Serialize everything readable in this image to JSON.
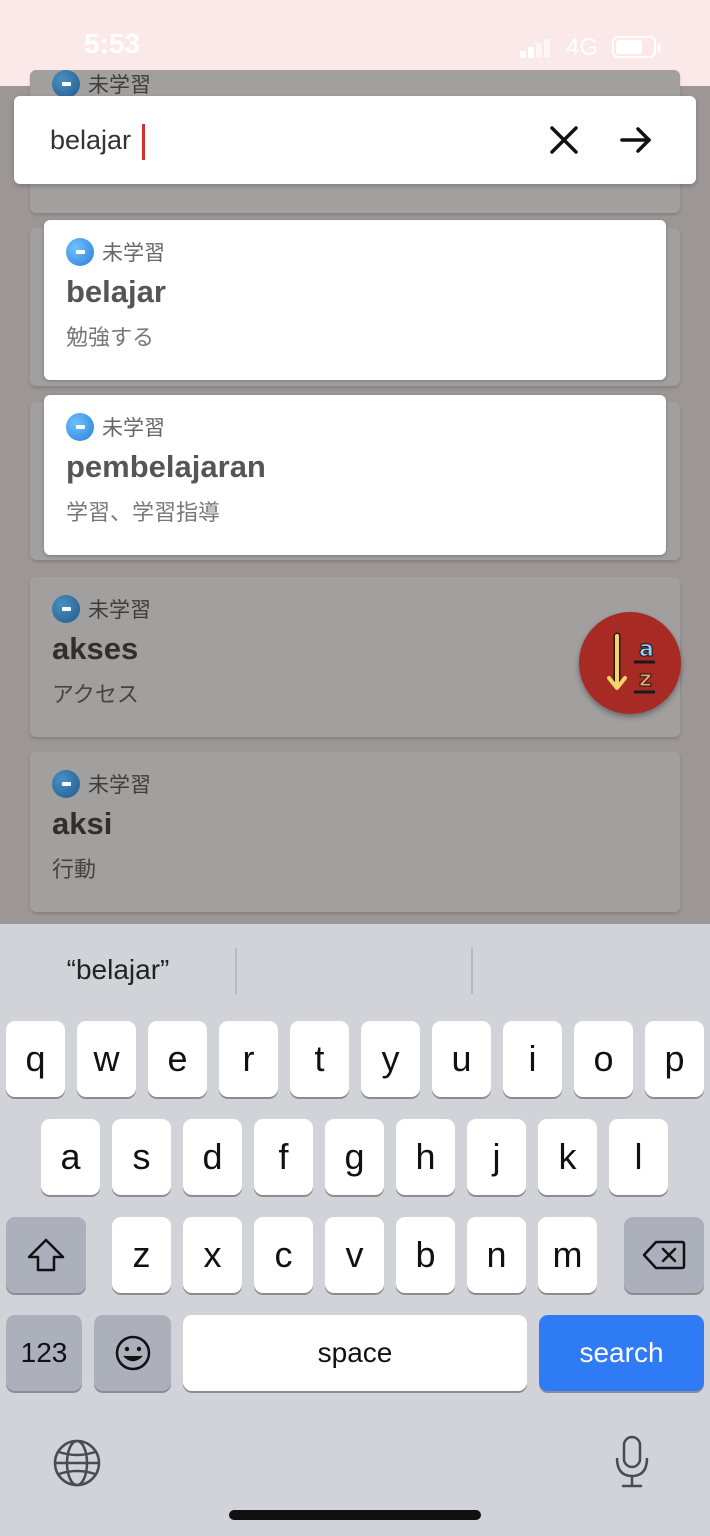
{
  "status_bar": {
    "time": "5:53",
    "network": "4G"
  },
  "search": {
    "value": "belajar"
  },
  "list": [
    {
      "status": "未学習",
      "word": "belajar",
      "meaning": "勉強する"
    },
    {
      "status": "未学習",
      "word": "pembelajaran",
      "meaning": "学習、学習指導"
    },
    {
      "status": "未学習",
      "word": "akses",
      "meaning": "アクセス"
    },
    {
      "status": "未学習",
      "word": "aksi",
      "meaning": "行動"
    },
    {
      "status": "未学習"
    }
  ],
  "fab": {
    "icon": "sort-a-z-icon",
    "top_letter": "a",
    "bottom_letter": "z"
  },
  "keyboard": {
    "suggestion": "“belajar”",
    "row1": [
      "q",
      "w",
      "e",
      "r",
      "t",
      "y",
      "u",
      "i",
      "o",
      "p"
    ],
    "row2": [
      "a",
      "s",
      "d",
      "f",
      "g",
      "h",
      "j",
      "k",
      "l"
    ],
    "row3": [
      "z",
      "x",
      "c",
      "v",
      "b",
      "n",
      "m"
    ],
    "numbers_label": "123",
    "space_label": "space",
    "search_label": "search"
  },
  "colors": {
    "accent": "#a82a25",
    "caret": "#d32f2f",
    "search_key": "#2f7af5",
    "status_bar": "#fbe9ea"
  }
}
